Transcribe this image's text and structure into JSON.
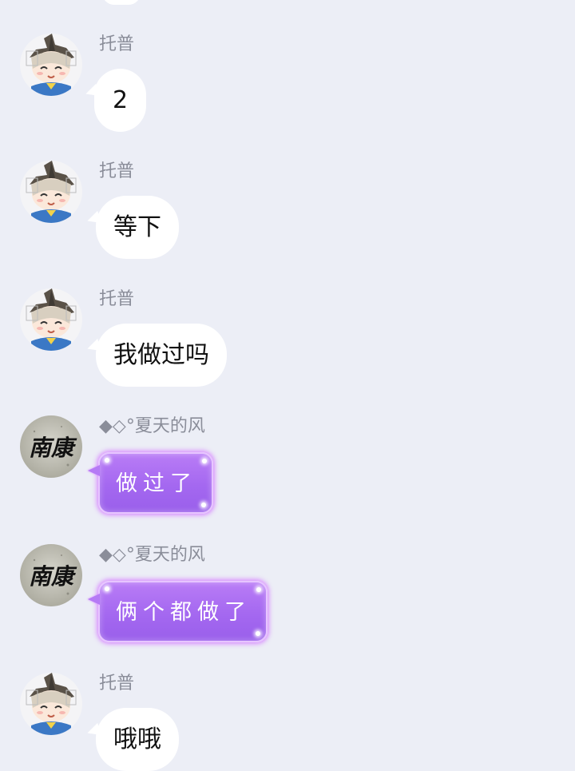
{
  "messages": [
    {
      "sender": "托普",
      "text": "2",
      "style": "white",
      "avatar": "anime-character-avatar-icon"
    },
    {
      "sender": "托普",
      "text": "等下",
      "style": "white",
      "avatar": "anime-character-avatar-icon"
    },
    {
      "sender": "托普",
      "text": "我做过吗",
      "style": "white",
      "avatar": "anime-character-avatar-icon"
    },
    {
      "sender": "◆◇°夏天的风",
      "text": "做过了",
      "style": "purple",
      "avatar": "calligraphy-avatar-icon",
      "avatar_text": "南康"
    },
    {
      "sender": "◆◇°夏天的风",
      "text": "俩个都做了",
      "style": "purple",
      "avatar": "calligraphy-avatar-icon",
      "avatar_text": "南康"
    },
    {
      "sender": "托普",
      "text": "哦哦",
      "style": "white",
      "avatar": "anime-character-avatar-icon"
    }
  ],
  "colors": {
    "background": "#eceef6",
    "white_bubble": "#ffffff",
    "purple_bubble": "#a86cf2",
    "sender_name": "#8a8d99"
  }
}
